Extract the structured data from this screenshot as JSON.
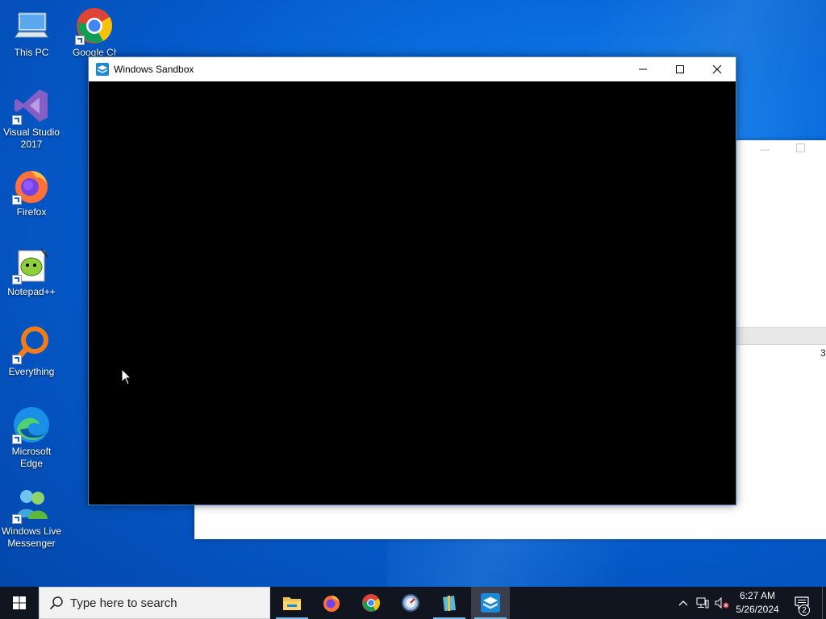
{
  "desktop": {
    "icons": [
      {
        "label": "This PC",
        "icon": "computer-icon"
      },
      {
        "label": "Google Chrome",
        "icon": "chrome-icon"
      },
      {
        "label": "Visual Studio 2017",
        "icon": "visual-studio-icon"
      },
      {
        "label": "Firefox",
        "icon": "firefox-icon"
      },
      {
        "label": "Notepad++",
        "icon": "notepadpp-icon"
      },
      {
        "label": "Everything",
        "icon": "everything-search-icon"
      },
      {
        "label": "Microsoft Edge",
        "icon": "edge-icon"
      },
      {
        "label": "Windows Live Messenger",
        "icon": "messenger-icon"
      }
    ]
  },
  "background_window": {
    "row_value": "3"
  },
  "sandbox_window": {
    "title": "Windows Sandbox",
    "minimize": "minimize",
    "maximize": "maximize",
    "close": "close",
    "content_color": "#000000"
  },
  "taskbar": {
    "search_placeholder": "Type here to search",
    "pinned_apps": [
      {
        "name": "File Explorer",
        "icon": "folder-icon"
      },
      {
        "name": "Firefox",
        "icon": "firefox-icon"
      },
      {
        "name": "Google Chrome",
        "icon": "chrome-icon"
      },
      {
        "name": "Tool",
        "icon": "gauge-icon"
      },
      {
        "name": "Archive",
        "icon": "archive-icon"
      },
      {
        "name": "Windows Sandbox",
        "icon": "sandbox-icon",
        "active": true
      }
    ],
    "clock_time": "6:27 AM",
    "clock_date": "5/26/2024",
    "notification_count": "2",
    "accent": "#76b9ed"
  }
}
